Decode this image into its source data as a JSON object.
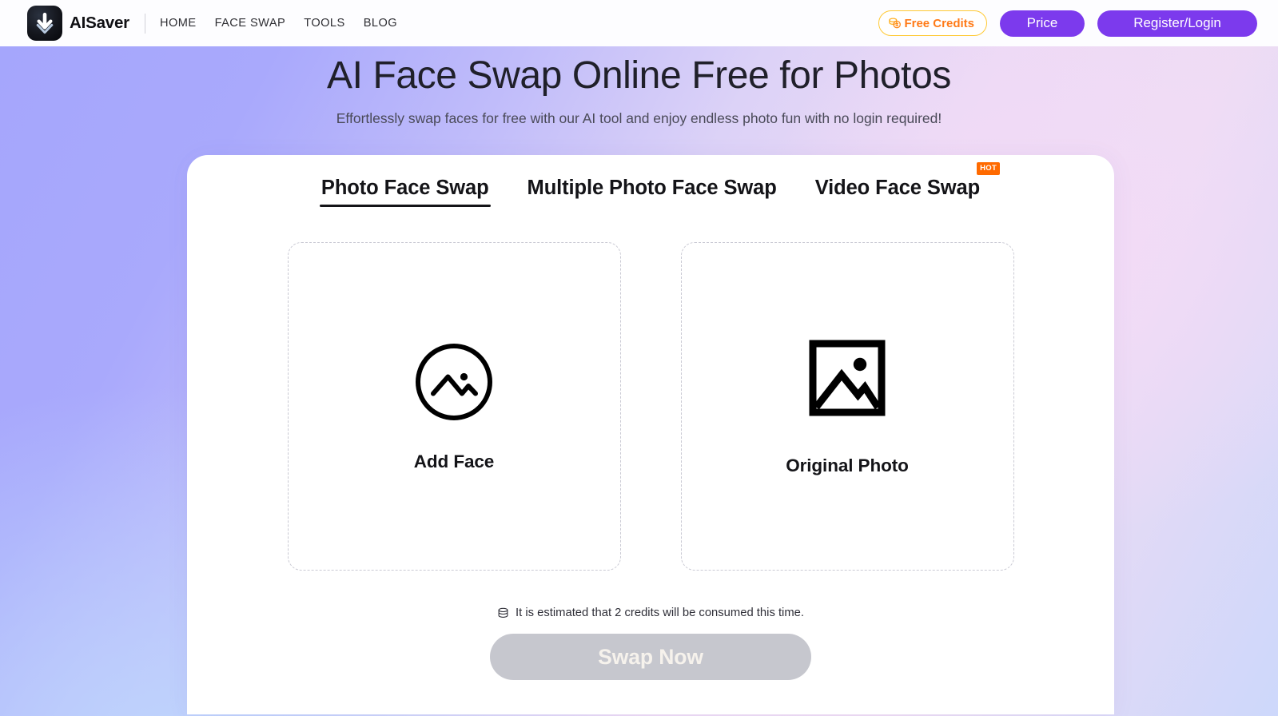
{
  "header": {
    "brand_name": "AISaver",
    "logo_icon": "download-arrow-icon",
    "nav": [
      {
        "label": "HOME"
      },
      {
        "label": "FACE SWAP"
      },
      {
        "label": "TOOLS"
      },
      {
        "label": "BLOG"
      }
    ],
    "free_credits_label": "Free Credits",
    "free_credits_icon": "coins-icon",
    "price_label": "Price",
    "register_label": "Register/Login"
  },
  "hero": {
    "title": "AI Face Swap Online Free for Photos",
    "subtitle": "Effortlessly swap faces for free with our AI tool and enjoy endless photo fun with no login required!"
  },
  "card": {
    "tabs": [
      {
        "label": "Photo Face Swap",
        "active": true,
        "badge": ""
      },
      {
        "label": "Multiple Photo Face Swap",
        "active": false,
        "badge": ""
      },
      {
        "label": "Video Face Swap",
        "active": false,
        "badge": "HOT"
      }
    ],
    "dropzones": [
      {
        "label": "Add Face",
        "icon": "circle-image-icon"
      },
      {
        "label": "Original Photo",
        "icon": "picture-frame-icon"
      }
    ],
    "credits_note": "It is estimated that 2 credits will be consumed this time.",
    "credits_note_icon": "coin-stack-icon",
    "swap_button_label": "Swap Now"
  },
  "colors": {
    "accent_purple": "#7c3aed",
    "credits_border": "#ffc933",
    "credits_text": "#ff7a17",
    "hot_badge": "#ff6a00",
    "swap_disabled": "#c6c7ce",
    "bg_left": "#a5a6fc",
    "bg_right": "#eddaf5",
    "bg_bottom_left": "#c5d7fa"
  }
}
